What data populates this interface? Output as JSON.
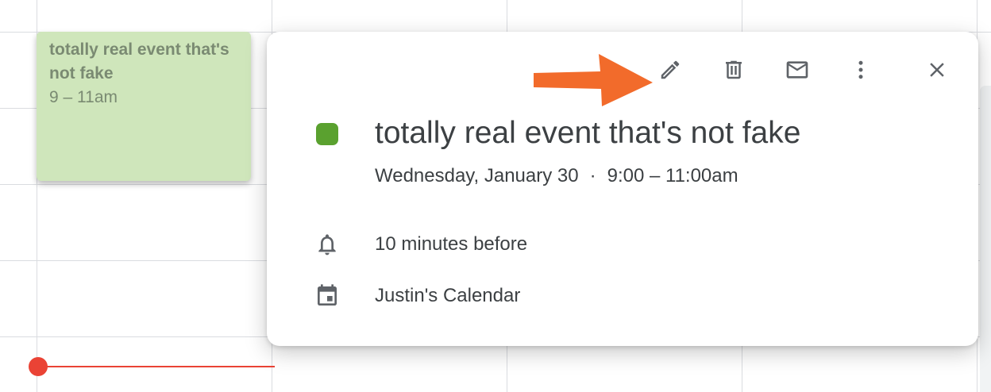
{
  "colors": {
    "event_color": "#5aa12f",
    "arrow_color": "#f26b2b",
    "now_indicator": "#ea4335",
    "chip_background": "#cfe6bb"
  },
  "event_chip": {
    "title": "totally real event that's not fake",
    "time": "9 – 11am"
  },
  "popup": {
    "toolbar": {
      "icons": [
        "pencil-icon",
        "trash-icon",
        "mail-icon",
        "more-vert-icon",
        "close-icon"
      ]
    },
    "event": {
      "title": "totally real event that's not fake",
      "date": "Wednesday, January 30",
      "separator": "·",
      "time": "9:00 – 11:00am"
    },
    "reminder": {
      "icon": "bell-icon",
      "text": "10 minutes before"
    },
    "calendar": {
      "icon": "calendar-icon",
      "text": "Justin's Calendar"
    }
  }
}
